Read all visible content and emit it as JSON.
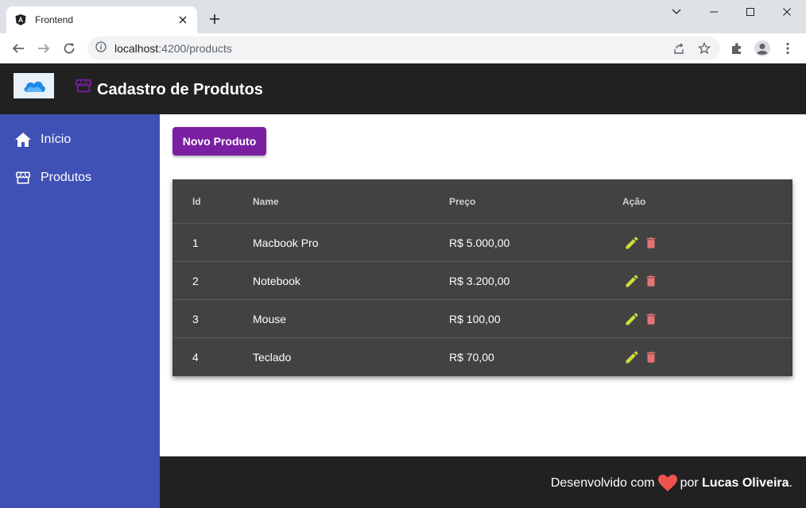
{
  "browser": {
    "tab_title": "Frontend",
    "url_host": "localhost",
    "url_path": ":4200/products"
  },
  "header": {
    "title": "Cadastro de Produtos"
  },
  "sidebar": {
    "items": [
      {
        "label": "Início",
        "icon": "home-icon"
      },
      {
        "label": "Produtos",
        "icon": "store-icon"
      }
    ]
  },
  "main": {
    "new_button_label": "Novo Produto",
    "table": {
      "columns": [
        "Id",
        "Name",
        "Preço",
        "Ação"
      ],
      "rows": [
        {
          "id": "1",
          "name": "Macbook Pro",
          "price": "R$ 5.000,00"
        },
        {
          "id": "2",
          "name": "Notebook",
          "price": "R$ 3.200,00"
        },
        {
          "id": "3",
          "name": "Mouse",
          "price": "R$ 100,00"
        },
        {
          "id": "4",
          "name": "Teclado",
          "price": "R$ 70,00"
        }
      ]
    }
  },
  "footer": {
    "prefix": "Desenvolvido com",
    "middle": "por",
    "author": "Lucas Oliveira",
    "suffix": "."
  },
  "colors": {
    "header_bg": "#212121",
    "sidebar_bg": "#3f51b5",
    "primary_button": "#7b1fa2",
    "table_bg": "#424242",
    "edit_icon": "#cddc39",
    "delete_icon": "#e57373",
    "heart": "#ef5350"
  }
}
